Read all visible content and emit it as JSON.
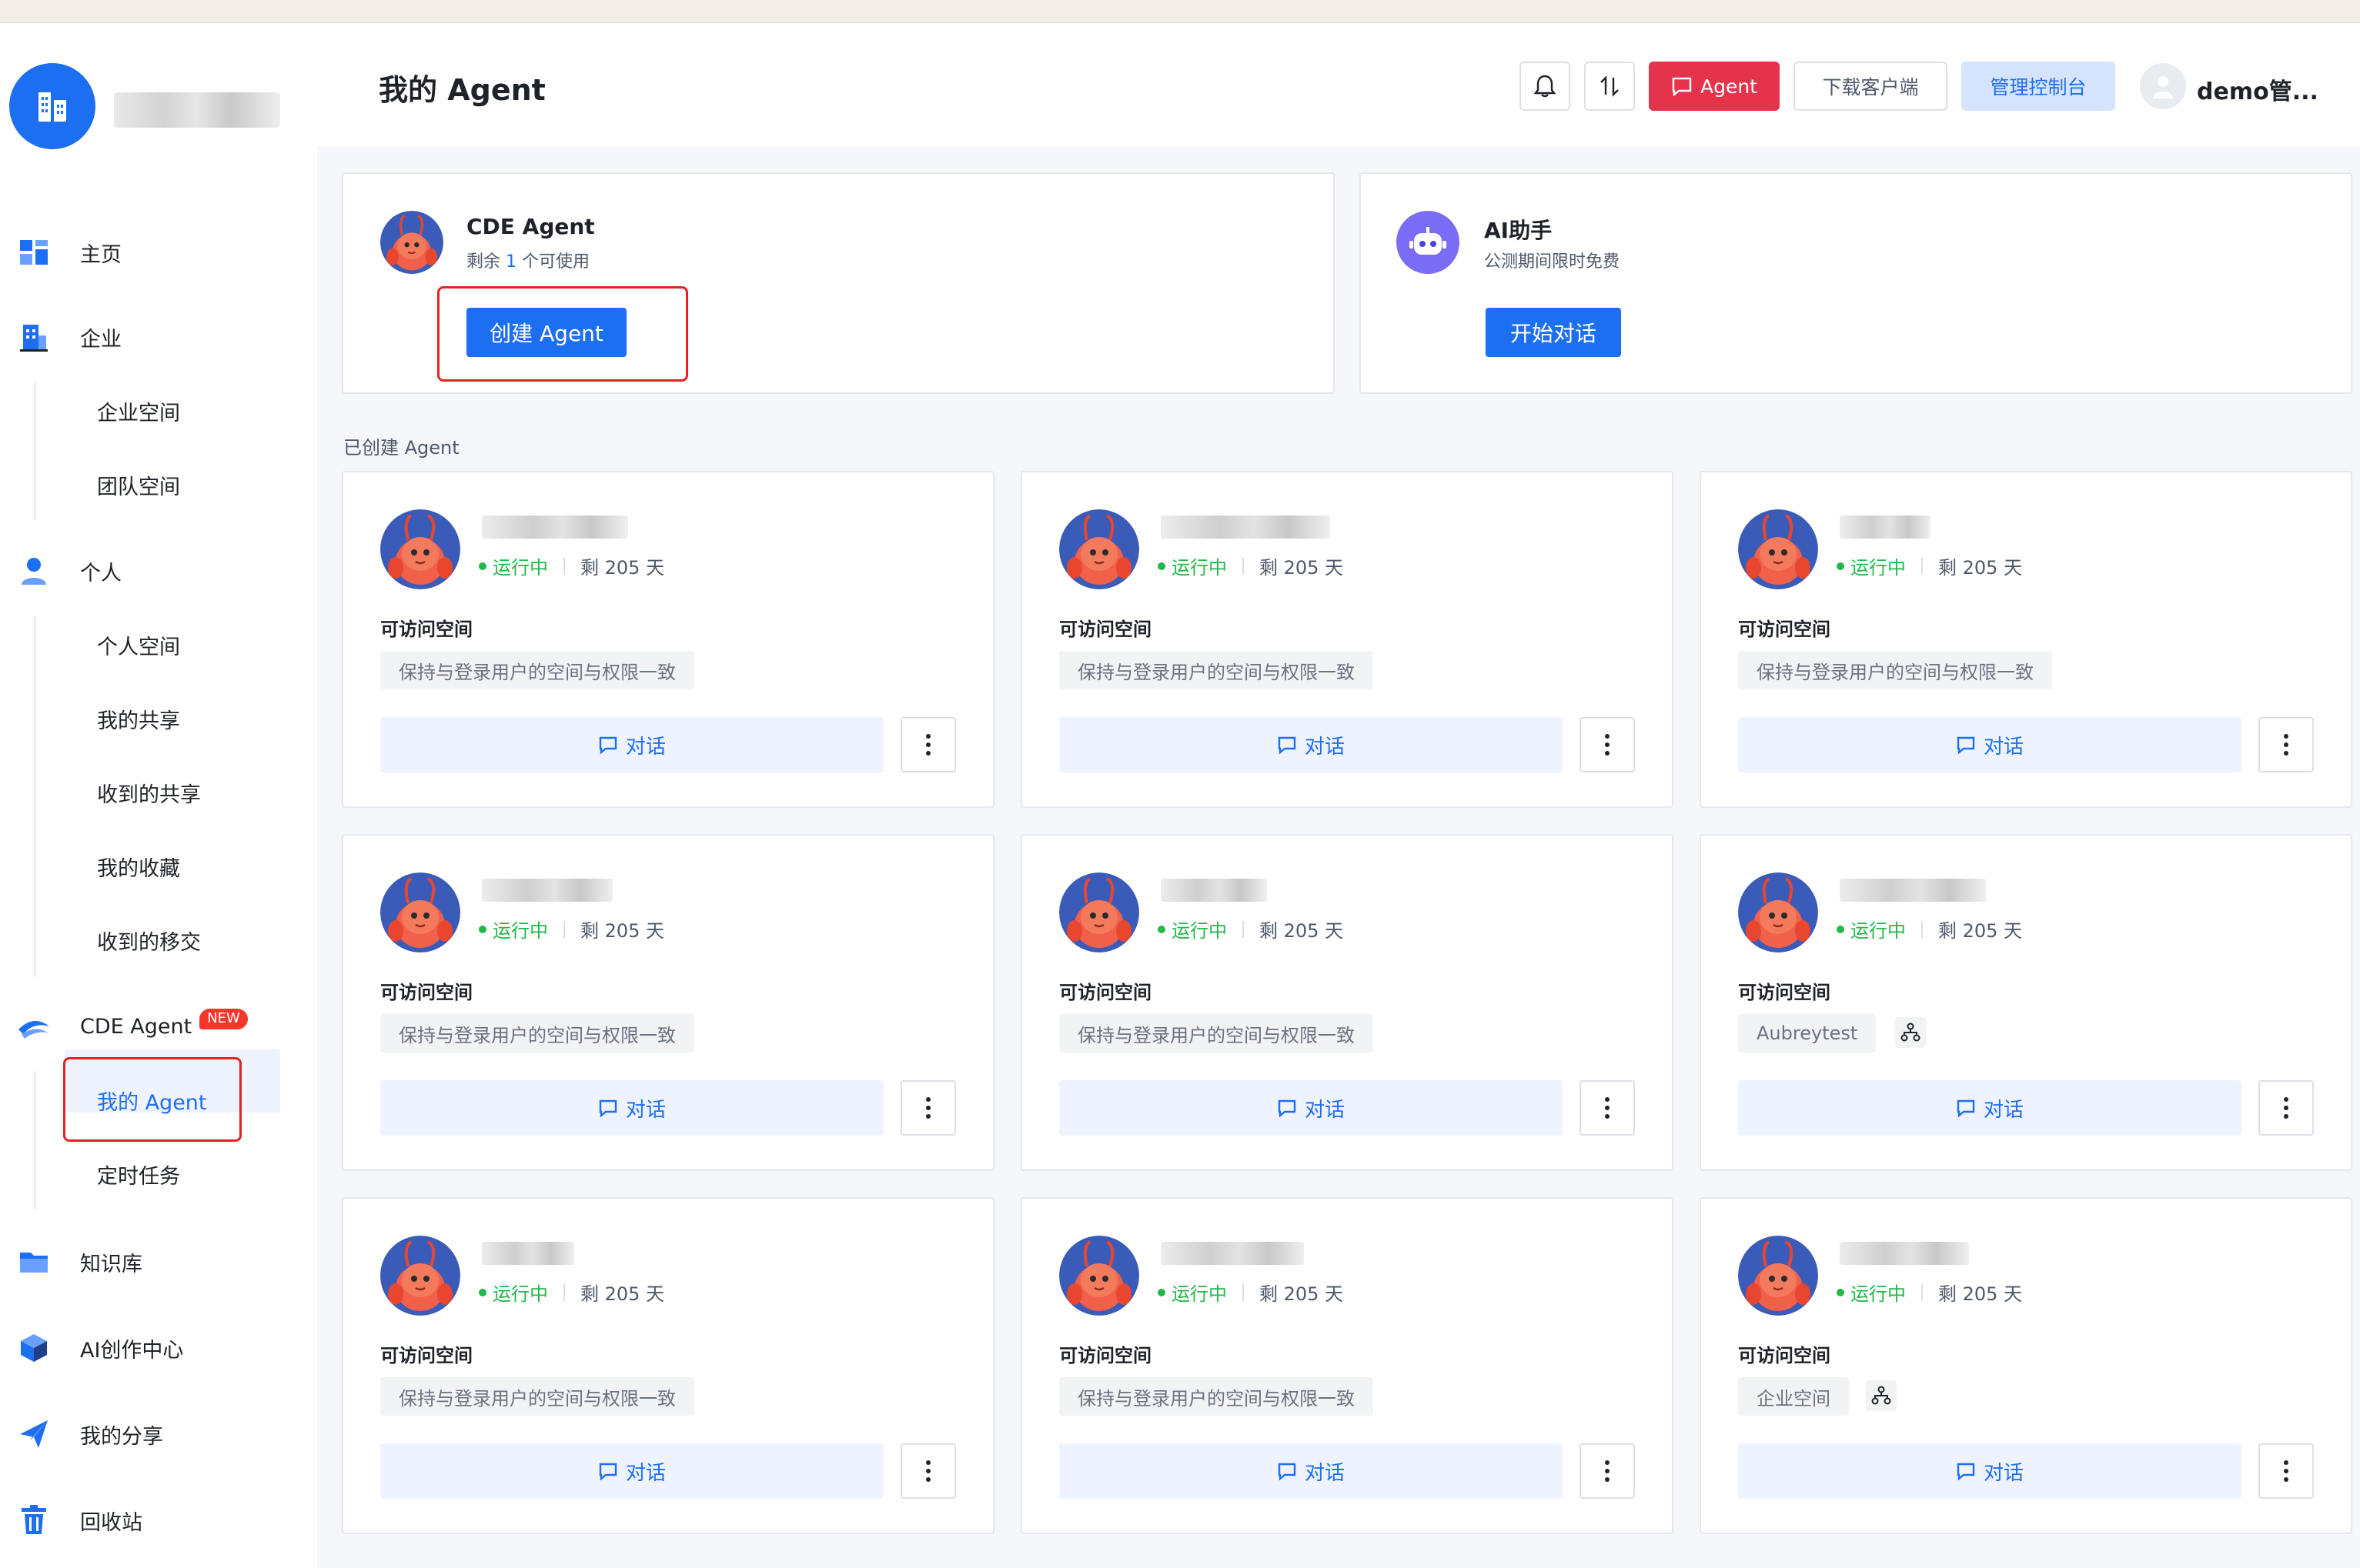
{
  "sidebar": {
    "items": [
      {
        "label": "主页",
        "icon": "dashboard-icon"
      },
      {
        "label": "企业",
        "icon": "building-icon"
      },
      {
        "label": "个人",
        "icon": "user-icon"
      },
      {
        "label": "CDE Agent",
        "icon": "agent-icon",
        "badge": "NEW"
      },
      {
        "label": "知识库",
        "icon": "folder-icon"
      },
      {
        "label": "AI创作中心",
        "icon": "cube-icon"
      },
      {
        "label": "我的分享",
        "icon": "send-icon"
      },
      {
        "label": "回收站",
        "icon": "trash-icon"
      }
    ],
    "enterprise_sub": [
      "企业空间",
      "团队空间"
    ],
    "personal_sub": [
      "个人空间",
      "我的共享",
      "收到的共享",
      "我的收藏",
      "收到的移交"
    ],
    "agent_sub": [
      "我的 Agent",
      "定时任务"
    ],
    "active_sub": "我的 Agent"
  },
  "header": {
    "title": "我的 Agent",
    "agent_button": "Agent",
    "download_button": "下载客户端",
    "admin_button": "管理控制台",
    "user_name": "demo管..."
  },
  "cde_panel": {
    "title": "CDE Agent",
    "remaining_prefix": "剩余",
    "remaining_count": "1",
    "remaining_suffix": "个可使用",
    "create_button": "创建 Agent"
  },
  "ai_panel": {
    "title": "AI助手",
    "subtitle": "公测期间限时免费",
    "start_button": "开始对话"
  },
  "section_label": "已创建 Agent",
  "cards": [
    {
      "status": "运行中",
      "remaining": "剩 205 天",
      "access_title": "可访问空间",
      "access": "保持与登录用户的空间与权限一致",
      "shared": false,
      "chat": "对话"
    },
    {
      "status": "运行中",
      "remaining": "剩 205 天",
      "access_title": "可访问空间",
      "access": "保持与登录用户的空间与权限一致",
      "shared": false,
      "chat": "对话"
    },
    {
      "status": "运行中",
      "remaining": "剩 205 天",
      "access_title": "可访问空间",
      "access": "保持与登录用户的空间与权限一致",
      "shared": false,
      "chat": "对话"
    },
    {
      "status": "运行中",
      "remaining": "剩 205 天",
      "access_title": "可访问空间",
      "access": "保持与登录用户的空间与权限一致",
      "shared": false,
      "chat": "对话"
    },
    {
      "status": "运行中",
      "remaining": "剩 205 天",
      "access_title": "可访问空间",
      "access": "保持与登录用户的空间与权限一致",
      "shared": false,
      "chat": "对话"
    },
    {
      "status": "运行中",
      "remaining": "剩 205 天",
      "access_title": "可访问空间",
      "access": "Aubreytest",
      "shared": true,
      "chat": "对话"
    },
    {
      "status": "运行中",
      "remaining": "剩 205 天",
      "access_title": "可访问空间",
      "access": "保持与登录用户的空间与权限一致",
      "shared": false,
      "chat": "对话"
    },
    {
      "status": "运行中",
      "remaining": "剩 205 天",
      "access_title": "可访问空间",
      "access": "保持与登录用户的空间与权限一致",
      "shared": false,
      "chat": "对话"
    },
    {
      "status": "运行中",
      "remaining": "剩 205 天",
      "access_title": "可访问空间",
      "access": "企业空间",
      "shared": true,
      "chat": "对话"
    }
  ],
  "colors": {
    "primary": "#1d6ff2",
    "agent_button": "#e5334b",
    "running": "#22b84a",
    "highlight_box": "#e02424"
  }
}
